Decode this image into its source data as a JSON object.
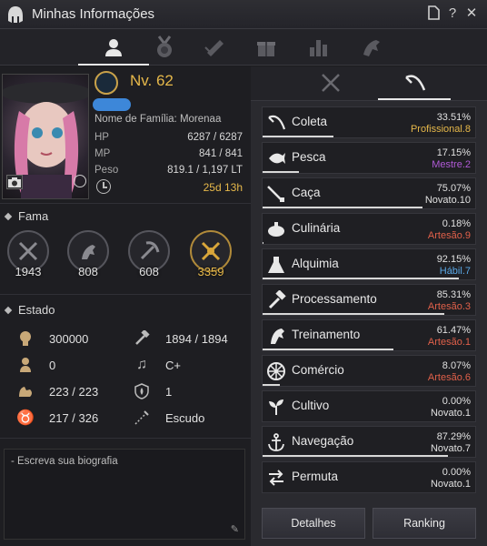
{
  "window": {
    "title": "Minhas Informações"
  },
  "titlebar_icons": [
    "document-icon",
    "help-icon",
    "close-icon"
  ],
  "top_tabs": [
    "profile-tab",
    "medal-tab",
    "scroll-tab",
    "gift-tab",
    "chart-tab",
    "horse-tab"
  ],
  "profile": {
    "level": "Nv. 62",
    "family_name": "Nome de Família: Morenaa",
    "stats": [
      {
        "label": "HP",
        "value": "6287 / 6287"
      },
      {
        "label": "MP",
        "value": "841 / 841"
      },
      {
        "label": "Peso",
        "value": "819.1 / 1,197 LT"
      }
    ],
    "time": "25d 13h"
  },
  "fame": {
    "title": "Fama",
    "items": [
      {
        "icon": "swords-icon",
        "value": "1943"
      },
      {
        "icon": "horse-icon",
        "value": "808"
      },
      {
        "icon": "pickaxe-icon",
        "value": "608"
      },
      {
        "icon": "crossed-tools-icon",
        "value": "3359"
      }
    ]
  },
  "estado": {
    "title": "Estado",
    "rows": [
      {
        "icon": "skull-icon",
        "value": "300000"
      },
      {
        "icon": "hammer-icon",
        "value": "1894 / 1894"
      },
      {
        "icon": "soldier-icon",
        "value": "0"
      },
      {
        "icon": "music-note-icon",
        "value": "C+"
      },
      {
        "icon": "muscle-icon",
        "value": "223 / 223"
      },
      {
        "icon": "shield-flame-icon",
        "value": "1"
      },
      {
        "icon": "taurus-icon",
        "value": "217 / 326"
      },
      {
        "icon": "sword-icon",
        "value": "Escudo"
      }
    ]
  },
  "bio": {
    "placeholder": "- Escreva sua biografia"
  },
  "skills": [
    {
      "name": "Coleta",
      "pct": "33.51%",
      "rank": "Profissional.8",
      "rank_color": "#e6b84a",
      "progress": 0.3351,
      "icon": "sickle-icon"
    },
    {
      "name": "Pesca",
      "pct": "17.15%",
      "rank": "Mestre.2",
      "rank_color": "#b05ad6",
      "progress": 0.1715,
      "icon": "fish-icon"
    },
    {
      "name": "Caça",
      "pct": "75.07%",
      "rank": "Novato.10",
      "rank_color": "#e0e0e0",
      "progress": 0.7507,
      "icon": "musket-icon"
    },
    {
      "name": "Culinária",
      "pct": "0.18%",
      "rank": "Artesão.9",
      "rank_color": "#e0604a",
      "progress": 0.0018,
      "icon": "pot-icon"
    },
    {
      "name": "Alquimia",
      "pct": "92.15%",
      "rank": "Hábil.7",
      "rank_color": "#5aa8e6",
      "progress": 0.9215,
      "icon": "flask-icon"
    },
    {
      "name": "Processamento",
      "pct": "85.31%",
      "rank": "Artesão.3",
      "rank_color": "#e0604a",
      "progress": 0.8531,
      "icon": "hammer-icon"
    },
    {
      "name": "Treinamento",
      "pct": "61.47%",
      "rank": "Artesão.1",
      "rank_color": "#e0604a",
      "progress": 0.6147,
      "icon": "horse-head-icon"
    },
    {
      "name": "Comércio",
      "pct": "8.07%",
      "rank": "Artesão.6",
      "rank_color": "#e0604a",
      "progress": 0.0807,
      "icon": "wheel-icon"
    },
    {
      "name": "Cultivo",
      "pct": "0.00%",
      "rank": "Novato.1",
      "rank_color": "#e0e0e0",
      "progress": 0.0,
      "icon": "sprout-icon"
    },
    {
      "name": "Navegação",
      "pct": "87.29%",
      "rank": "Novato.7",
      "rank_color": "#e0e0e0",
      "progress": 0.8729,
      "icon": "anchor-icon"
    },
    {
      "name": "Permuta",
      "pct": "0.00%",
      "rank": "Novato.1",
      "rank_color": "#e0e0e0",
      "progress": 0.0,
      "icon": "swap-arrows-icon"
    }
  ],
  "buttons": {
    "details": "Detalhes",
    "ranking": "Ranking"
  }
}
